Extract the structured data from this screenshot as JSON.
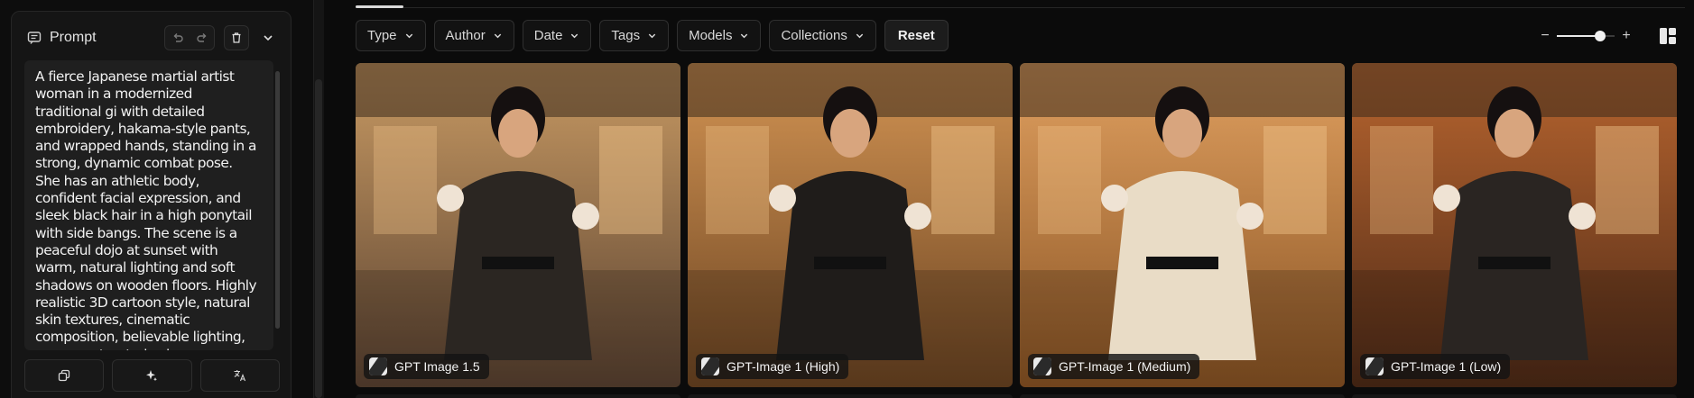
{
  "prompt_panel": {
    "title": "Prompt",
    "text": "A fierce Japanese martial artist woman in a modernized traditional gi with detailed embroidery, hakama-style pants, and wrapped hands, standing in a strong, dynamic combat pose. She has an athletic body, confident facial expression, and sleek black hair in a high ponytail with side bangs. The scene is a peaceful dojo at sunset with warm, natural lighting and soft shadows on wooden floors. Highly realistic 3D cartoon style, natural skin textures, cinematic composition, believable lighting, no oversaturated colors."
  },
  "filters": [
    {
      "label": "Type"
    },
    {
      "label": "Author"
    },
    {
      "label": "Date"
    },
    {
      "label": "Tags"
    },
    {
      "label": "Models"
    },
    {
      "label": "Collections"
    }
  ],
  "reset_label": "Reset",
  "zoom": {
    "minus": "−",
    "plus": "+",
    "level": 0.75
  },
  "cards": [
    {
      "model": "GPT Image 1.5",
      "top_color": "#c89a63",
      "bottom_color": "#5a4231",
      "outfit": "#2b2622"
    },
    {
      "model": "GPT-Image 1 (High)",
      "top_color": "#d39453",
      "bottom_color": "#6b4422",
      "outfit": "#1f1c1a"
    },
    {
      "model": "GPT-Image 1 (Medium)",
      "top_color": "#e0a060",
      "bottom_color": "#8a5424",
      "outfit": "#e9dcc6"
    },
    {
      "model": "GPT-Image 1 (Low)",
      "top_color": "#b8652f",
      "bottom_color": "#4e2a17",
      "outfit": "#2a2522"
    }
  ],
  "colors": {
    "accent": "#e8e8e8",
    "panel": "#151515",
    "chip_bg": "#141414"
  }
}
